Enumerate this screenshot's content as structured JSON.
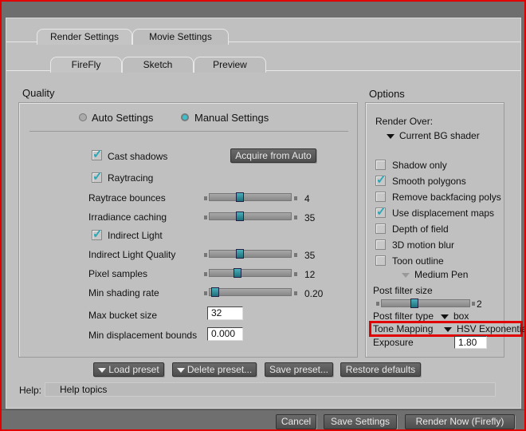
{
  "tabs": {
    "top": [
      {
        "label": "Render Settings"
      },
      {
        "label": "Movie Settings"
      }
    ],
    "sub": [
      {
        "label": "FireFly"
      },
      {
        "label": "Sketch"
      },
      {
        "label": "Preview"
      }
    ]
  },
  "quality": {
    "title": "Quality",
    "auto_label": "Auto Settings",
    "manual_label": "Manual Settings",
    "selected": "manual",
    "cast_shadows": {
      "label": "Cast shadows",
      "checked": true
    },
    "acquire_label": "Acquire from Auto",
    "raytracing": {
      "label": "Raytracing",
      "checked": true
    },
    "indirect_light": {
      "label": "Indirect Light",
      "checked": true
    },
    "sliders": [
      {
        "label": "Raytrace bounces",
        "value": "4",
        "fraction": 0.35
      },
      {
        "label": "Irradiance caching",
        "value": "35",
        "fraction": 0.35
      },
      {
        "label": "Indirect Light Quality",
        "value": "35",
        "fraction": 0.35
      },
      {
        "label": "Pixel samples",
        "value": "12",
        "fraction": 0.32
      },
      {
        "label": "Min shading rate",
        "value": "0.20",
        "fraction": 0.02
      }
    ],
    "max_bucket": {
      "label": "Max bucket size",
      "value": "32"
    },
    "min_disp": {
      "label": "Min displacement bounds",
      "value": "0.000"
    }
  },
  "options": {
    "title": "Options",
    "render_over_label": "Render Over:",
    "render_over_value": "Current BG shader",
    "checks": [
      {
        "label": "Shadow only",
        "checked": false
      },
      {
        "label": "Smooth polygons",
        "checked": true
      },
      {
        "label": "Remove backfacing polys",
        "checked": false
      },
      {
        "label": "Use displacement maps",
        "checked": true
      },
      {
        "label": "Depth of field",
        "checked": false
      },
      {
        "label": "3D motion blur",
        "checked": false
      },
      {
        "label": "Toon outline",
        "checked": false
      }
    ],
    "pen": "Medium Pen",
    "post_filter_size": {
      "label": "Post filter size",
      "value": "2",
      "fraction": 0.35
    },
    "post_filter_type": {
      "label": "Post filter type",
      "value": "box"
    },
    "tone_mapping": {
      "label": "Tone Mapping",
      "value": "HSV Exponential"
    },
    "exposure": {
      "label": "Exposure",
      "value": "1.80"
    }
  },
  "presets": {
    "load": "Load preset",
    "delete": "Delete preset...",
    "save": "Save preset...",
    "restore": "Restore defaults"
  },
  "help": {
    "label": "Help:",
    "value": "Help topics"
  },
  "footer": {
    "cancel": "Cancel",
    "save": "Save Settings",
    "render": "Render Now (Firefly)"
  },
  "colors": {
    "highlight": "#e00000",
    "accent": "#2aa8b8"
  }
}
